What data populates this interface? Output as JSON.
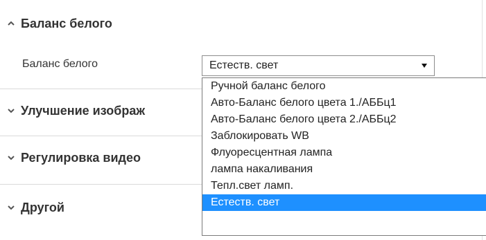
{
  "sections": {
    "white_balance": {
      "title": "Баланс белого",
      "expanded": true
    },
    "image_enhancement": {
      "title": "Улучшение изображ",
      "expanded": false
    },
    "video_adjustment": {
      "title": "Регулировка видео",
      "expanded": false
    },
    "other": {
      "title": "Другой",
      "expanded": false
    }
  },
  "white_balance_field": {
    "label": "Баланс белого",
    "selected_value": "Естеств. свет",
    "options": [
      "Ручной баланс белого",
      "Авто-Баланс белого цвета 1./АББц1",
      "Авто-Баланс белого цвета 2./АББц2",
      "Заблокировать WB",
      "Флуоресцентная лампа",
      "лампа накаливания",
      "Тепл.свет ламп.",
      "Естеств. свет"
    ],
    "highlighted_option_index": 7
  },
  "icons": {
    "expanded": "chevron-up-icon",
    "collapsed": "chevron-down-icon",
    "select_arrow": "triangle-down-icon"
  },
  "colors": {
    "highlight": "#1e90ff",
    "text": "#333333",
    "divider": "#d9d9d9"
  }
}
